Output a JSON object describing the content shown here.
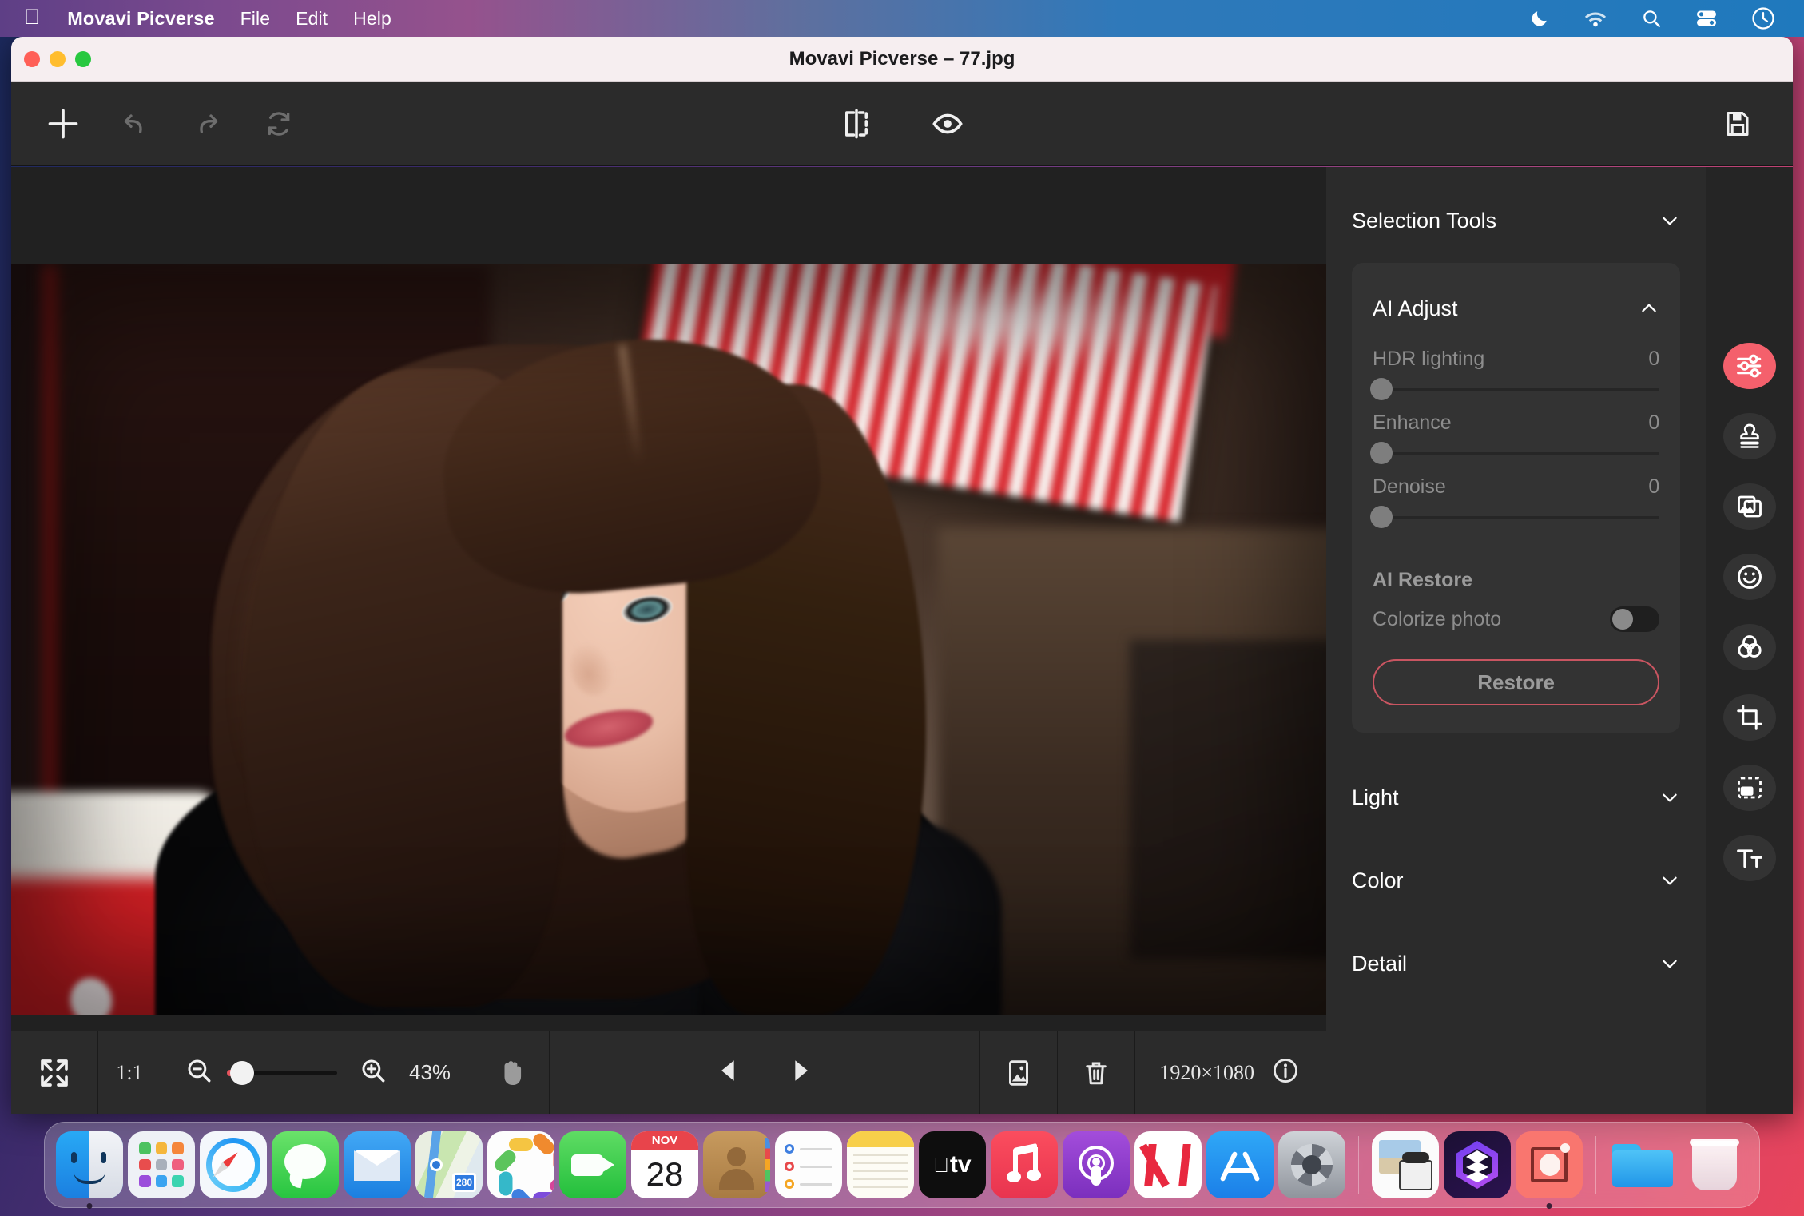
{
  "menubar": {
    "apple_icon": "apple-icon",
    "items": [
      {
        "label": "Movavi Picverse",
        "bold": true
      },
      {
        "label": "File",
        "bold": false
      },
      {
        "label": "Edit",
        "bold": false
      },
      {
        "label": "Help",
        "bold": false
      }
    ],
    "status_icons": [
      "moon-icon",
      "wifi-icon",
      "search-icon",
      "control-center-icon",
      "clock-icon"
    ]
  },
  "window": {
    "title": "Movavi Picverse – 77.jpg",
    "traffic_lights": [
      "close",
      "minimize",
      "zoom"
    ]
  },
  "toolbar": {
    "left": [
      {
        "name": "add-button",
        "icon": "plus-icon",
        "enabled": true
      },
      {
        "name": "undo-button",
        "icon": "undo-icon",
        "enabled": false
      },
      {
        "name": "redo-button",
        "icon": "redo-icon",
        "enabled": false
      },
      {
        "name": "reset-button",
        "icon": "reset-icon",
        "enabled": false
      }
    ],
    "center": [
      {
        "name": "compare-button",
        "icon": "before-after-icon"
      },
      {
        "name": "preview-button",
        "icon": "eye-icon"
      }
    ],
    "right": [
      {
        "name": "save-button",
        "icon": "floppy-save-icon"
      }
    ]
  },
  "panel": {
    "selection_tools": {
      "label": "Selection Tools",
      "expanded": false,
      "chevron": "chevron-down-icon"
    },
    "ai_adjust": {
      "label": "AI Adjust",
      "expanded": true,
      "chevron": "chevron-up-icon",
      "sliders": [
        {
          "label": "HDR lighting",
          "value": "0",
          "percent": 0
        },
        {
          "label": "Enhance",
          "value": "0",
          "percent": 0
        },
        {
          "label": "Denoise",
          "value": "0",
          "percent": 0
        }
      ],
      "ai_restore": {
        "title": "AI Restore",
        "colorize_label": "Colorize photo",
        "colorize_on": false,
        "restore_button": "Restore",
        "restore_border_color": "#c95561"
      }
    },
    "collapsed_sections": [
      {
        "label": "Light",
        "chevron": "chevron-down-icon"
      },
      {
        "label": "Color",
        "chevron": "chevron-down-icon"
      },
      {
        "label": "Detail",
        "chevron": "chevron-down-icon"
      }
    ]
  },
  "toolrail": {
    "accent_color": "#f4606c",
    "items": [
      {
        "name": "adjust-sliders-icon",
        "active": true
      },
      {
        "name": "stamp-icon",
        "active": false
      },
      {
        "name": "object-removal-icon",
        "active": false
      },
      {
        "name": "retouch-face-icon",
        "active": false
      },
      {
        "name": "color-mixer-icon",
        "active": false
      },
      {
        "name": "crop-icon",
        "active": false
      },
      {
        "name": "canvas-resize-icon",
        "active": false
      },
      {
        "name": "text-tool-icon",
        "active": false
      }
    ]
  },
  "bottombar": {
    "fit_icon": "fit-to-screen-icon",
    "ratio_label": "1:1",
    "zoom_out_icon": "zoom-out-icon",
    "zoom_in_icon": "zoom-in-icon",
    "zoom_level": "43%",
    "zoom_percent": 12,
    "hand_icon": "hand-tool-icon",
    "prev_icon": "previous-image-icon",
    "next_icon": "next-image-icon",
    "thumbnail_icon": "image-panel-icon",
    "delete_icon": "trash-icon",
    "dimensions": "1920×1080",
    "info_icon": "info-icon"
  },
  "dock": {
    "items": [
      {
        "name": "finder",
        "running": true
      },
      {
        "name": "launchpad",
        "running": false
      },
      {
        "name": "safari",
        "running": false
      },
      {
        "name": "messages",
        "running": false
      },
      {
        "name": "mail",
        "running": false
      },
      {
        "name": "maps",
        "running": false
      },
      {
        "name": "photos",
        "running": false
      },
      {
        "name": "facetime",
        "running": false
      },
      {
        "name": "calendar",
        "running": false,
        "month": "NOV",
        "day": "28"
      },
      {
        "name": "contacts",
        "running": false
      },
      {
        "name": "reminders",
        "running": false
      },
      {
        "name": "notes",
        "running": false
      },
      {
        "name": "appletv",
        "running": false,
        "label": "tv"
      },
      {
        "name": "music",
        "running": false
      },
      {
        "name": "podcasts",
        "running": false
      },
      {
        "name": "news",
        "running": false
      },
      {
        "name": "appstore",
        "running": false
      },
      {
        "name": "system-preferences",
        "running": false
      },
      {
        "separator": true
      },
      {
        "name": "image-capture",
        "running": false
      },
      {
        "name": "layers-app",
        "running": false
      },
      {
        "name": "movavi-picverse",
        "running": true
      },
      {
        "separator": true
      },
      {
        "name": "downloads-folder",
        "running": false
      },
      {
        "name": "trash",
        "running": false
      }
    ]
  }
}
